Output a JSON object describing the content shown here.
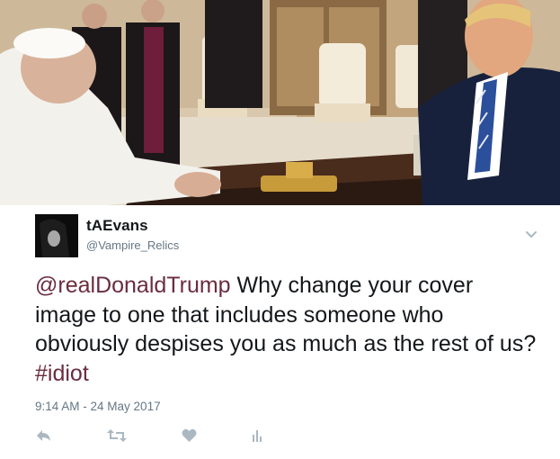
{
  "photo": {
    "description_icon": "photo-pope-and-president"
  },
  "tweet": {
    "display_name": "tAEvans",
    "handle": "@Vampire_Relics",
    "text": {
      "mention": "@realDonaldTrump",
      "body": " Why change your cover image to one that includes someone who obviously despises you as much as the rest of us? ",
      "hashtag": "#idiot"
    },
    "timestamp": "9:14 AM - 24 May 2017"
  },
  "icons": {
    "menu": "chevron-down-icon",
    "reply": "reply-icon",
    "retweet": "retweet-icon",
    "like": "heart-icon",
    "analytics": "analytics-icon"
  },
  "colors": {
    "link": "#6b2c3f",
    "muted": "#657786",
    "icon": "#aab8c2",
    "text": "#14171a"
  }
}
